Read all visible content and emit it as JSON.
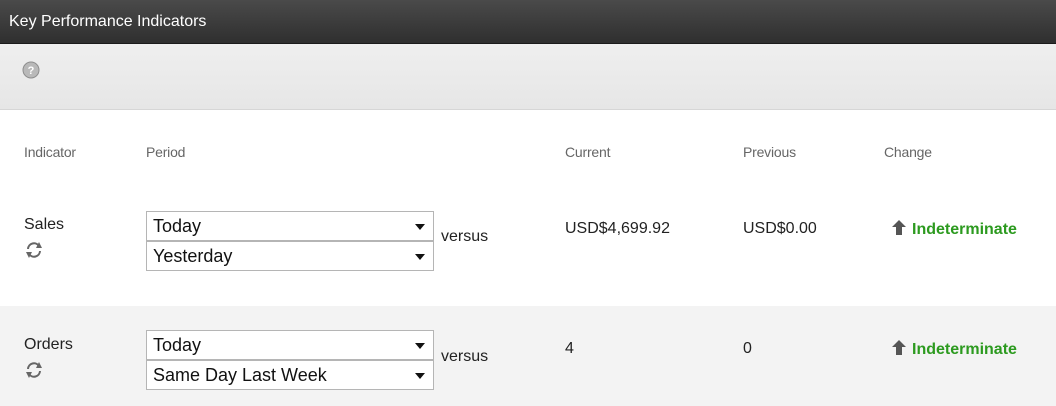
{
  "window": {
    "title": "Key Performance Indicators"
  },
  "toolbar": {
    "help_icon": "help-icon"
  },
  "columns": {
    "indicator": "Indicator",
    "period": "Period",
    "current": "Current",
    "previous": "Previous",
    "change": "Change"
  },
  "rows": [
    {
      "indicator": "Sales",
      "period_primary": "Today",
      "versus": "versus",
      "period_compare": "Yesterday",
      "current": "USD$4,699.92",
      "previous": "USD$0.00",
      "change": "Indeterminate"
    },
    {
      "indicator": "Orders",
      "period_primary": "Today",
      "versus": "versus",
      "period_compare": "Same Day Last Week",
      "current": "4",
      "previous": "0",
      "change": "Indeterminate"
    }
  ],
  "colors": {
    "change_positive": "#2c9a1f",
    "titlebar": "#3a3a3a"
  }
}
